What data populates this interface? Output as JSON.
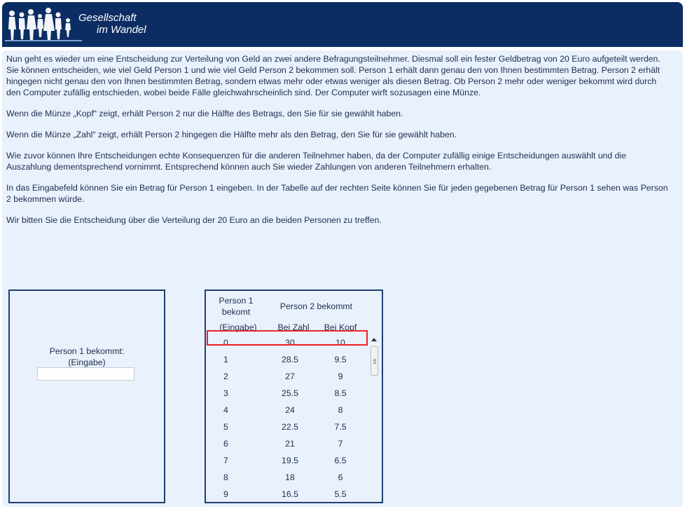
{
  "header": {
    "logo_line1": "Gesellschaft",
    "logo_line2": "im Wandel",
    "bg_color": "#0c2d63"
  },
  "content": {
    "paragraphs": [
      "Nun geht es wieder um eine Entscheidung zur Verteilung von Geld an zwei andere Befragungsteilnehmer. Diesmal soll ein fester Geldbetrag von 20 Euro aufgeteilt werden. Sie können entscheiden, wie viel Geld Person 1 und wie viel Geld Person 2 bekommen soll. Person 1 erhält dann genau den von Ihnen bestimmten Betrag. Person 2 erhält hingegen nicht genau den von Ihnen bestimmten Betrag, sondern etwas mehr oder etwas weniger als diesen Betrag. Ob Person 2 mehr oder weniger bekommt wird durch den Computer zufällig entschieden, wobei beide Fälle gleichwahrscheinlich sind. Der Computer wirft sozusagen eine Münze.",
      "Wenn die Münze „Kopf“ zeigt, erhält Person 2 nur die Hälfte des Betrags, den Sie für sie gewählt haben.",
      "Wenn die Münze „Zahl“ zeigt, erhält Person 2 hingegen die Hälfte mehr als den Betrag, den Sie für sie gewählt haben.",
      "Wie zuvor können Ihre Entscheidungen echte Konsequenzen für die anderen Teilnehmer haben, da der Computer zufällig einige Entscheidungen auswählt und die Auszahlung dementsprechend vornimmt. Entsprechend können auch Sie wieder Zahlungen von anderen Teilnehmern erhalten.",
      "In das Eingabefeld können Sie ein Betrag für Person 1 eingeben. In der Tabelle auf der rechten Seite können Sie für jeden gegebenen Betrag für Person 1 sehen was Person 2 bekommen würde.",
      "Wir bitten Sie die Entscheidung über die Verteilung der 20 Euro an die beiden Personen zu treffen."
    ]
  },
  "input_box": {
    "label_line1": "Person 1 bekommt:",
    "label_line2": "(Eingabe)",
    "value": ""
  },
  "table": {
    "col1_header_line1": "Person 1",
    "col1_header_line2": "bekomt",
    "col1_header_line3": "(Eingabe)",
    "group_header": "Person 2 bekommt",
    "col2_header": "Bei Zahl",
    "col3_header": "Bei Kopf",
    "rows": [
      {
        "p1": "0",
        "zahl": "30",
        "kopf": "10"
      },
      {
        "p1": "1",
        "zahl": "28.5",
        "kopf": "9.5"
      },
      {
        "p1": "2",
        "zahl": "27",
        "kopf": "9"
      },
      {
        "p1": "3",
        "zahl": "25.5",
        "kopf": "8.5"
      },
      {
        "p1": "4",
        "zahl": "24",
        "kopf": "8"
      },
      {
        "p1": "5",
        "zahl": "22.5",
        "kopf": "7.5"
      },
      {
        "p1": "6",
        "zahl": "21",
        "kopf": "7"
      },
      {
        "p1": "7",
        "zahl": "19.5",
        "kopf": "6.5"
      },
      {
        "p1": "8",
        "zahl": "18",
        "kopf": "6"
      },
      {
        "p1": "9",
        "zahl": "16.5",
        "kopf": "5.5"
      }
    ],
    "highlight_color": "#e8242a"
  }
}
